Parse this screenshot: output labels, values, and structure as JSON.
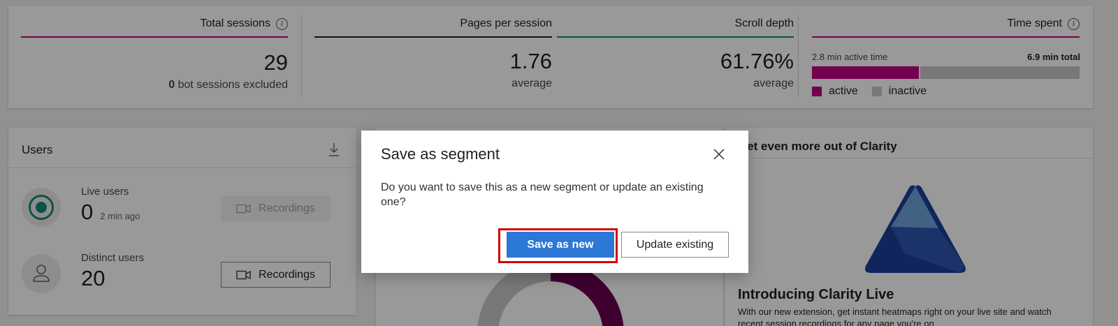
{
  "metrics": {
    "total_sessions": {
      "title": "Total sessions",
      "value": "29",
      "sub_bold": "0",
      "sub_text": " bot sessions excluded",
      "color": "#c00083"
    },
    "pages_per_session": {
      "title": "Pages per session",
      "value": "1.76",
      "sub": "average",
      "color": "#201f1e"
    },
    "scroll_depth": {
      "title": "Scroll depth",
      "value": "61.76%",
      "sub": "average",
      "color": "#0f8a7e"
    },
    "time_spent": {
      "title": "Time spent",
      "active_text": "2.8 min active time",
      "total_text": "6.9 min total",
      "active_fraction": 0.406,
      "legend_active": "active",
      "legend_inactive": "inactive",
      "active_color": "#c00083",
      "inactive_color": "#c8c8c8"
    }
  },
  "users_card": {
    "title": "Users",
    "live": {
      "label": "Live users",
      "value": "0",
      "ago": "2 min ago",
      "button": "Recordings"
    },
    "distinct": {
      "label": "Distinct users",
      "value": "20",
      "button": "Recordings"
    }
  },
  "promo_card": {
    "title": "Get even more out of Clarity",
    "headline": "Introducing Clarity Live",
    "body": "With our new extension, get instant heatmaps right on your live site and watch recent session recordings for any page you're on"
  },
  "dialog": {
    "title": "Save as segment",
    "message": "Do you want to save this as a new segment or update an existing one?",
    "primary_button": "Save as new",
    "secondary_button": "Update existing"
  }
}
